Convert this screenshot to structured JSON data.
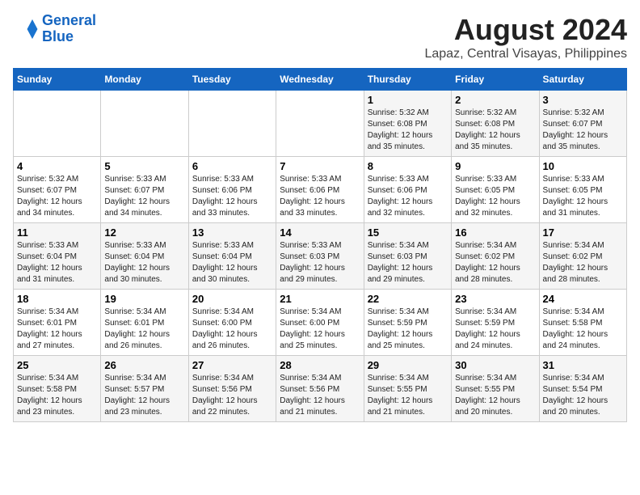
{
  "logo": {
    "line1": "General",
    "line2": "Blue"
  },
  "title": "August 2024",
  "subtitle": "Lapaz, Central Visayas, Philippines",
  "days_of_week": [
    "Sunday",
    "Monday",
    "Tuesday",
    "Wednesday",
    "Thursday",
    "Friday",
    "Saturday"
  ],
  "weeks": [
    [
      {
        "day": "",
        "sunrise": "",
        "sunset": "",
        "daylight": ""
      },
      {
        "day": "",
        "sunrise": "",
        "sunset": "",
        "daylight": ""
      },
      {
        "day": "",
        "sunrise": "",
        "sunset": "",
        "daylight": ""
      },
      {
        "day": "",
        "sunrise": "",
        "sunset": "",
        "daylight": ""
      },
      {
        "day": "1",
        "sunrise": "Sunrise: 5:32 AM",
        "sunset": "Sunset: 6:08 PM",
        "daylight": "Daylight: 12 hours and 35 minutes."
      },
      {
        "day": "2",
        "sunrise": "Sunrise: 5:32 AM",
        "sunset": "Sunset: 6:08 PM",
        "daylight": "Daylight: 12 hours and 35 minutes."
      },
      {
        "day": "3",
        "sunrise": "Sunrise: 5:32 AM",
        "sunset": "Sunset: 6:07 PM",
        "daylight": "Daylight: 12 hours and 35 minutes."
      }
    ],
    [
      {
        "day": "4",
        "sunrise": "Sunrise: 5:32 AM",
        "sunset": "Sunset: 6:07 PM",
        "daylight": "Daylight: 12 hours and 34 minutes."
      },
      {
        "day": "5",
        "sunrise": "Sunrise: 5:33 AM",
        "sunset": "Sunset: 6:07 PM",
        "daylight": "Daylight: 12 hours and 34 minutes."
      },
      {
        "day": "6",
        "sunrise": "Sunrise: 5:33 AM",
        "sunset": "Sunset: 6:06 PM",
        "daylight": "Daylight: 12 hours and 33 minutes."
      },
      {
        "day": "7",
        "sunrise": "Sunrise: 5:33 AM",
        "sunset": "Sunset: 6:06 PM",
        "daylight": "Daylight: 12 hours and 33 minutes."
      },
      {
        "day": "8",
        "sunrise": "Sunrise: 5:33 AM",
        "sunset": "Sunset: 6:06 PM",
        "daylight": "Daylight: 12 hours and 32 minutes."
      },
      {
        "day": "9",
        "sunrise": "Sunrise: 5:33 AM",
        "sunset": "Sunset: 6:05 PM",
        "daylight": "Daylight: 12 hours and 32 minutes."
      },
      {
        "day": "10",
        "sunrise": "Sunrise: 5:33 AM",
        "sunset": "Sunset: 6:05 PM",
        "daylight": "Daylight: 12 hours and 31 minutes."
      }
    ],
    [
      {
        "day": "11",
        "sunrise": "Sunrise: 5:33 AM",
        "sunset": "Sunset: 6:04 PM",
        "daylight": "Daylight: 12 hours and 31 minutes."
      },
      {
        "day": "12",
        "sunrise": "Sunrise: 5:33 AM",
        "sunset": "Sunset: 6:04 PM",
        "daylight": "Daylight: 12 hours and 30 minutes."
      },
      {
        "day": "13",
        "sunrise": "Sunrise: 5:33 AM",
        "sunset": "Sunset: 6:04 PM",
        "daylight": "Daylight: 12 hours and 30 minutes."
      },
      {
        "day": "14",
        "sunrise": "Sunrise: 5:33 AM",
        "sunset": "Sunset: 6:03 PM",
        "daylight": "Daylight: 12 hours and 29 minutes."
      },
      {
        "day": "15",
        "sunrise": "Sunrise: 5:34 AM",
        "sunset": "Sunset: 6:03 PM",
        "daylight": "Daylight: 12 hours and 29 minutes."
      },
      {
        "day": "16",
        "sunrise": "Sunrise: 5:34 AM",
        "sunset": "Sunset: 6:02 PM",
        "daylight": "Daylight: 12 hours and 28 minutes."
      },
      {
        "day": "17",
        "sunrise": "Sunrise: 5:34 AM",
        "sunset": "Sunset: 6:02 PM",
        "daylight": "Daylight: 12 hours and 28 minutes."
      }
    ],
    [
      {
        "day": "18",
        "sunrise": "Sunrise: 5:34 AM",
        "sunset": "Sunset: 6:01 PM",
        "daylight": "Daylight: 12 hours and 27 minutes."
      },
      {
        "day": "19",
        "sunrise": "Sunrise: 5:34 AM",
        "sunset": "Sunset: 6:01 PM",
        "daylight": "Daylight: 12 hours and 26 minutes."
      },
      {
        "day": "20",
        "sunrise": "Sunrise: 5:34 AM",
        "sunset": "Sunset: 6:00 PM",
        "daylight": "Daylight: 12 hours and 26 minutes."
      },
      {
        "day": "21",
        "sunrise": "Sunrise: 5:34 AM",
        "sunset": "Sunset: 6:00 PM",
        "daylight": "Daylight: 12 hours and 25 minutes."
      },
      {
        "day": "22",
        "sunrise": "Sunrise: 5:34 AM",
        "sunset": "Sunset: 5:59 PM",
        "daylight": "Daylight: 12 hours and 25 minutes."
      },
      {
        "day": "23",
        "sunrise": "Sunrise: 5:34 AM",
        "sunset": "Sunset: 5:59 PM",
        "daylight": "Daylight: 12 hours and 24 minutes."
      },
      {
        "day": "24",
        "sunrise": "Sunrise: 5:34 AM",
        "sunset": "Sunset: 5:58 PM",
        "daylight": "Daylight: 12 hours and 24 minutes."
      }
    ],
    [
      {
        "day": "25",
        "sunrise": "Sunrise: 5:34 AM",
        "sunset": "Sunset: 5:58 PM",
        "daylight": "Daylight: 12 hours and 23 minutes."
      },
      {
        "day": "26",
        "sunrise": "Sunrise: 5:34 AM",
        "sunset": "Sunset: 5:57 PM",
        "daylight": "Daylight: 12 hours and 23 minutes."
      },
      {
        "day": "27",
        "sunrise": "Sunrise: 5:34 AM",
        "sunset": "Sunset: 5:56 PM",
        "daylight": "Daylight: 12 hours and 22 minutes."
      },
      {
        "day": "28",
        "sunrise": "Sunrise: 5:34 AM",
        "sunset": "Sunset: 5:56 PM",
        "daylight": "Daylight: 12 hours and 21 minutes."
      },
      {
        "day": "29",
        "sunrise": "Sunrise: 5:34 AM",
        "sunset": "Sunset: 5:55 PM",
        "daylight": "Daylight: 12 hours and 21 minutes."
      },
      {
        "day": "30",
        "sunrise": "Sunrise: 5:34 AM",
        "sunset": "Sunset: 5:55 PM",
        "daylight": "Daylight: 12 hours and 20 minutes."
      },
      {
        "day": "31",
        "sunrise": "Sunrise: 5:34 AM",
        "sunset": "Sunset: 5:54 PM",
        "daylight": "Daylight: 12 hours and 20 minutes."
      }
    ]
  ]
}
